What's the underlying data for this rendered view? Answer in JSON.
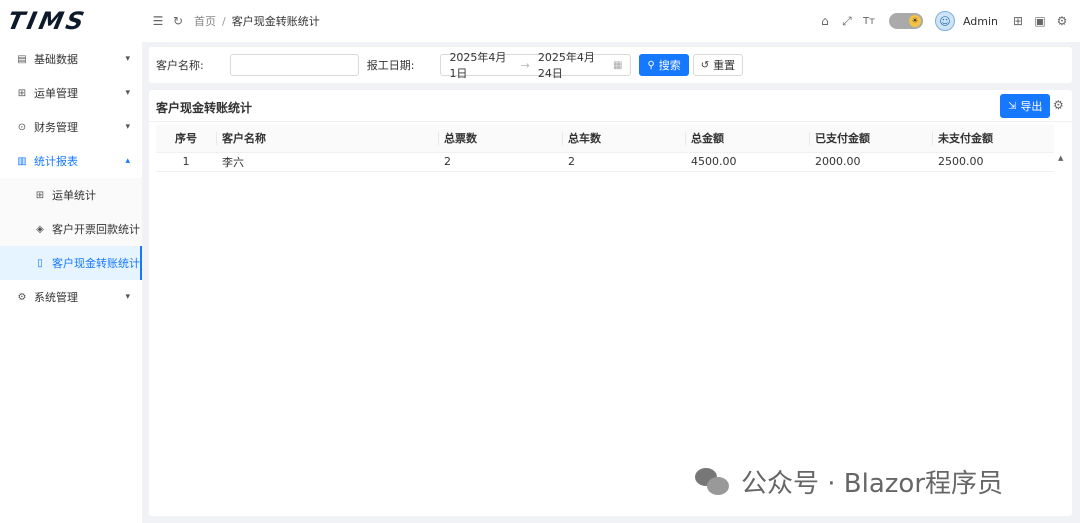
{
  "app": {
    "logo": "TIMS"
  },
  "header": {
    "breadcrumb_home": "首页",
    "breadcrumb_sep": "/",
    "breadcrumb_current": "客户现金转账统计",
    "user_name": "Admin"
  },
  "sidebar": {
    "items": [
      {
        "label": "基础数据",
        "icon": "document-icon",
        "chevron": "⌄"
      },
      {
        "label": "运单管理",
        "icon": "grid-icon",
        "chevron": "⌄"
      },
      {
        "label": "财务管理",
        "icon": "circle-icon",
        "chevron": "⌄"
      },
      {
        "label": "统计报表",
        "icon": "bar-chart-icon",
        "chevron": "⌃"
      },
      {
        "label": "系统管理",
        "icon": "gear-icon",
        "chevron": "⌄"
      }
    ],
    "sub_items": [
      {
        "label": "运单统计",
        "icon": "table-icon"
      },
      {
        "label": "客户开票回款统计",
        "icon": "shield-icon"
      },
      {
        "label": "客户现金转账统计",
        "icon": "file-icon"
      }
    ],
    "accent_color": "#1677ff"
  },
  "search": {
    "customer_label": "客户名称:",
    "customer_value": "",
    "date_label": "报工日期:",
    "date_start": "2025年4月1日",
    "date_arrow": "→",
    "date_end": "2025年4月24日",
    "search_button": "搜索",
    "reset_button": "重置"
  },
  "table_panel": {
    "title": "客户现金转账统计",
    "export_button": "导出",
    "columns": [
      "序号",
      "客户名称",
      "总票数",
      "总车数",
      "总金额",
      "已支付金额",
      "未支付金额"
    ],
    "rows": [
      {
        "index": "1",
        "customer": "李六",
        "tickets": "2",
        "vehicles": "2",
        "total": "4500.00",
        "paid": "2000.00",
        "unpaid": "2500.00"
      }
    ]
  },
  "watermark": {
    "text": "公众号 · Blazor程序员"
  }
}
